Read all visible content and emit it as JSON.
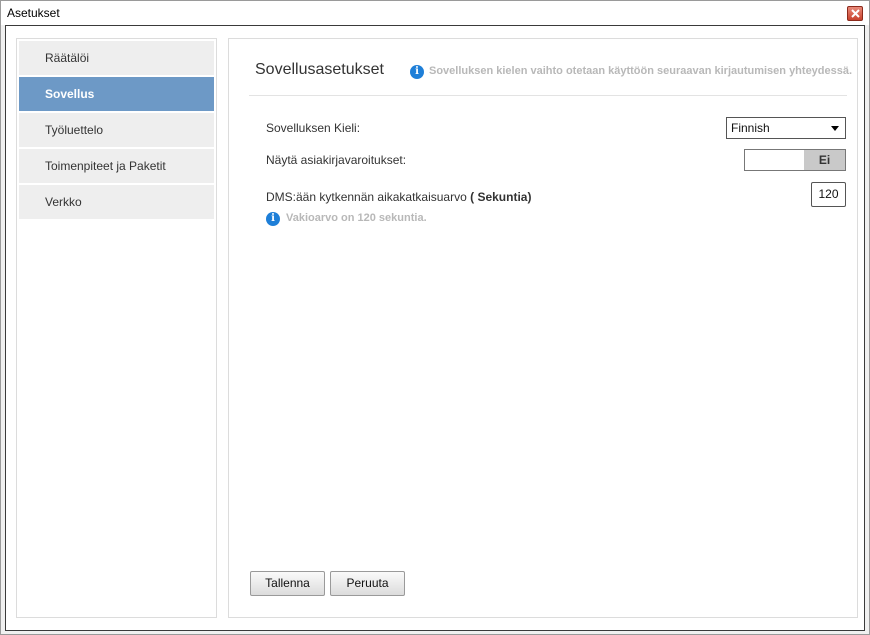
{
  "window": {
    "title": "Asetukset"
  },
  "sidebar": {
    "items": [
      {
        "label": "Räätälöi"
      },
      {
        "label": "Sovellus"
      },
      {
        "label": "Työluettelo"
      },
      {
        "label": "Toimenpiteet ja Paketit"
      },
      {
        "label": "Verkko"
      }
    ],
    "active_index": 1
  },
  "main": {
    "heading": "Sovellusasetukset",
    "info_note": "Sovelluksen kielen vaihto otetaan käyttöön seuraavan kirjautumisen yhteydessä.",
    "language": {
      "label": "Sovelluksen Kieli:",
      "value": "Finnish"
    },
    "show_warnings": {
      "label": "Näytä asiakirjavaroitukset:",
      "value": "Ei"
    },
    "timeout": {
      "label": "DMS:ään kytkennän aikakatkaisuarvo",
      "unit": "( Sekuntia)",
      "value": "120",
      "hint": "Vakioarvo on 120 sekuntia."
    }
  },
  "buttons": {
    "save": "Tallenna",
    "cancel": "Peruuta"
  },
  "colors": {
    "active_nav": "#6d99c6",
    "info_icon": "#1e7fd8"
  }
}
